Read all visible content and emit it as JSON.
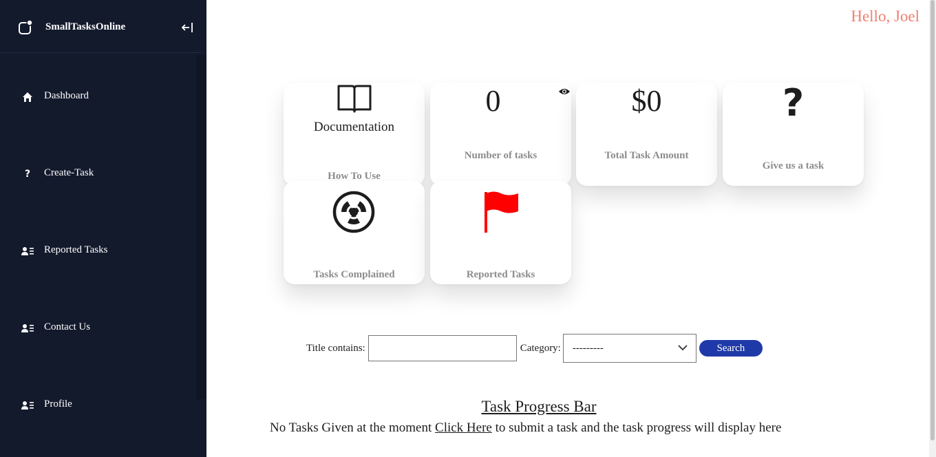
{
  "brand": {
    "name": "SmallTasksOnline"
  },
  "sidebar": {
    "items": [
      {
        "label": "Dashboard",
        "icon": "home-icon"
      },
      {
        "label": "Create-Task",
        "icon": "question-icon"
      },
      {
        "label": "Reported Tasks",
        "icon": "user-list-icon"
      },
      {
        "label": "Contact Us",
        "icon": "user-list-icon"
      },
      {
        "label": "Profile",
        "icon": "user-list-icon"
      }
    ]
  },
  "header": {
    "greeting": "Hello, Joel"
  },
  "cards": {
    "documentation": {
      "label": "Documentation",
      "caption": "How To Use",
      "icon": "book-icon"
    },
    "tasks_count": {
      "value": "0",
      "caption": "Number of tasks",
      "icon": "eye-icon"
    },
    "total_amount": {
      "value": "$0",
      "caption": "Total Task Amount"
    },
    "give_task": {
      "symbol": "?",
      "caption": "Give us a task"
    },
    "complained": {
      "caption": "Tasks Complained",
      "icon": "radiation-icon"
    },
    "reported": {
      "caption": "Reported Tasks",
      "icon": "flag-icon",
      "icon_color": "#ff0000"
    }
  },
  "search": {
    "title_label": "Title contains:",
    "title_value": "",
    "category_label": "Category:",
    "category_selected": "---------",
    "button_label": "Search"
  },
  "progress": {
    "title": "Task Progress Bar",
    "message_before": "No Tasks Given at the moment",
    "link_text": "Click Here",
    "message_after": "to submit a task and the task progress will display here"
  },
  "colors": {
    "sidebar_bg": "#131a2c",
    "greeting": "#f08070",
    "search_button": "#1f3aa8"
  }
}
